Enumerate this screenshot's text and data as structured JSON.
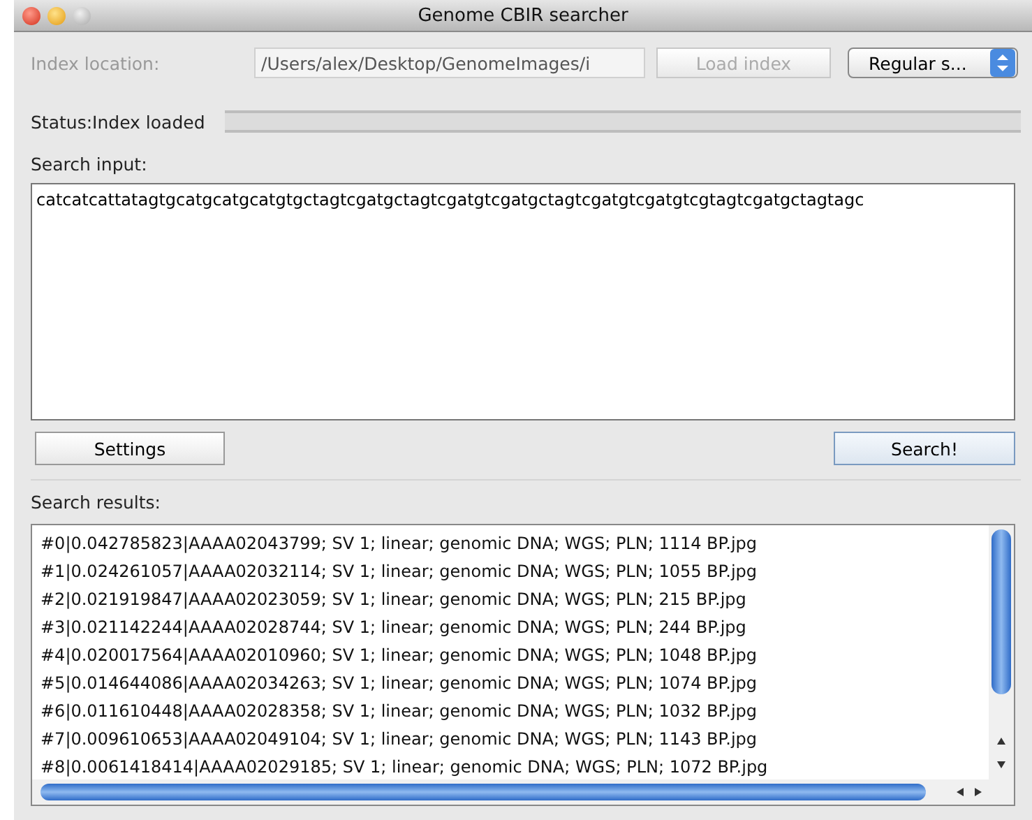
{
  "window": {
    "title": "Genome CBIR searcher"
  },
  "index": {
    "label": "Index location:",
    "value": "/Users/alex/Desktop/GenomeImages/i",
    "button": "Load index",
    "disabled": true
  },
  "mode_select": {
    "value": "Regular s..."
  },
  "status": {
    "text": "Status:Index loaded"
  },
  "search_input": {
    "label": "Search input:",
    "value": "catcatcattatagtgcatgcatgcatgtgctagtcgatgctagtcgatgtcgatgctagtcgatgtcgatgtcgtagtcgatgctagtagc"
  },
  "buttons": [
    {
      "label": "Settings",
      "kind": "plain"
    },
    {
      "label": "Search!",
      "kind": "default"
    }
  ],
  "results": {
    "label": "Search results:",
    "rows": [
      "#0|0.042785823|AAAA02043799; SV 1; linear; genomic DNA; WGS; PLN; 1114 BP.jpg",
      "#1|0.024261057|AAAA02032114; SV 1; linear; genomic DNA; WGS; PLN; 1055 BP.jpg",
      "#2|0.021919847|AAAA02023059; SV 1; linear; genomic DNA; WGS; PLN; 215 BP.jpg",
      "#3|0.021142244|AAAA02028744; SV 1; linear; genomic DNA; WGS; PLN; 244 BP.jpg",
      "#4|0.020017564|AAAA02010960; SV 1; linear; genomic DNA; WGS; PLN; 1048 BP.jpg",
      "#5|0.014644086|AAAA02034263; SV 1; linear; genomic DNA; WGS; PLN; 1074 BP.jpg",
      "#6|0.011610448|AAAA02028358; SV 1; linear; genomic DNA; WGS; PLN; 1032 BP.jpg",
      "#7|0.009610653|AAAA02049104; SV 1; linear; genomic DNA; WGS; PLN; 1143 BP.jpg",
      "#8|0.0061418414|AAAA02029185; SV 1; linear; genomic DNA; WGS; PLN; 1072 BP.jpg"
    ]
  }
}
